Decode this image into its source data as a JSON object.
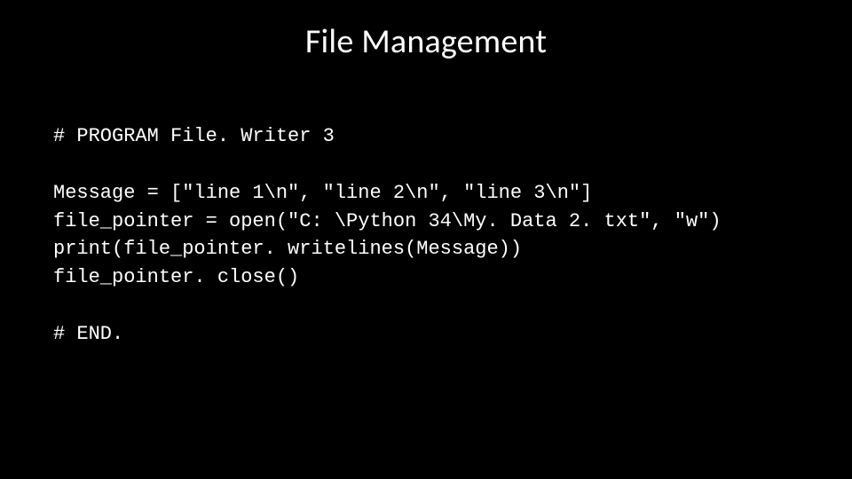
{
  "slide": {
    "title": "File Management",
    "code": {
      "comment_top": "# PROGRAM File. Writer 3",
      "line1": "Message = [\"line 1\\n\", \"line 2\\n\", \"line 3\\n\"]",
      "line2": "file_pointer = open(\"C: \\Python 34\\My. Data 2. txt\", \"w\")",
      "line3": "print(file_pointer. writelines(Message))",
      "line4": "file_pointer. close()",
      "comment_end": "# END."
    }
  }
}
